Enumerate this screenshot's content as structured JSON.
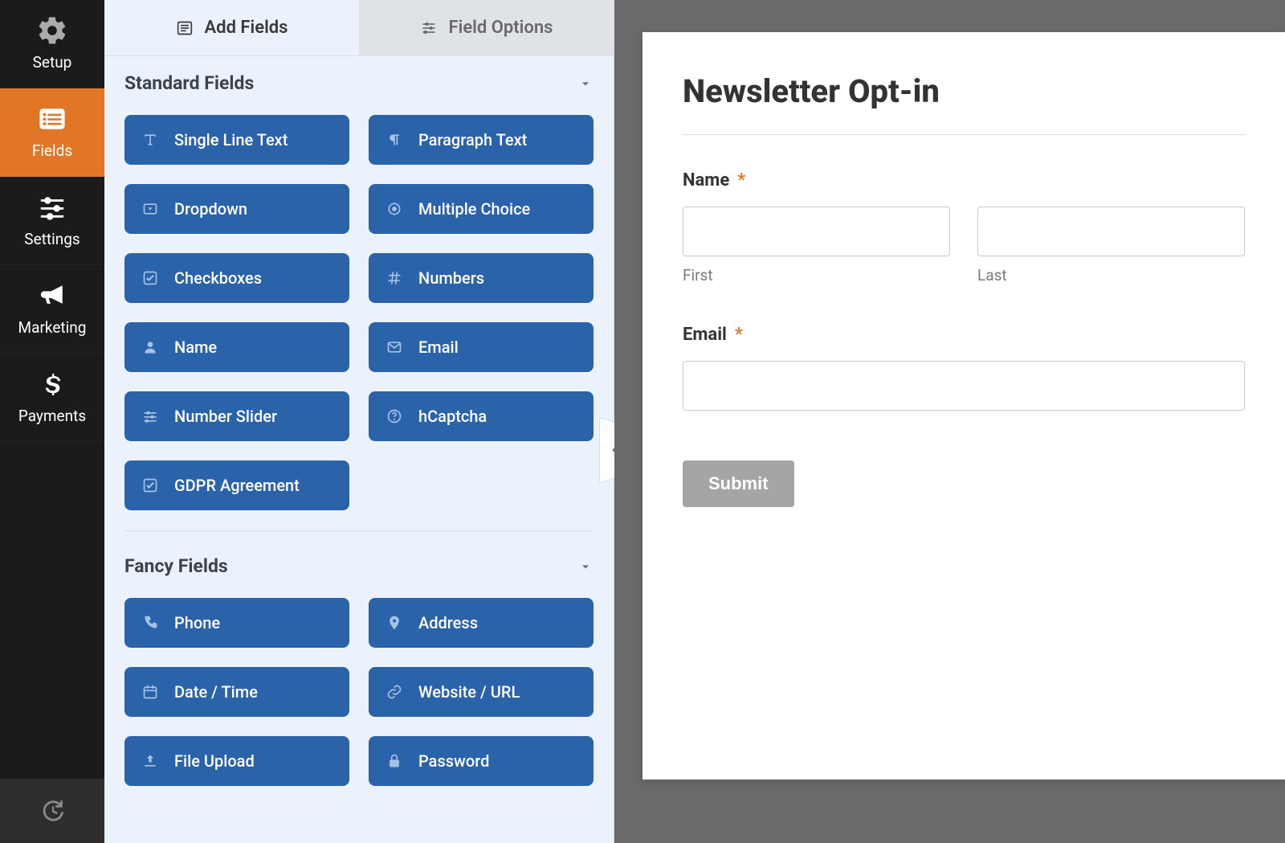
{
  "nav": {
    "items": [
      {
        "id": "setup",
        "label": "Setup"
      },
      {
        "id": "fields",
        "label": "Fields"
      },
      {
        "id": "settings",
        "label": "Settings"
      },
      {
        "id": "marketing",
        "label": "Marketing"
      },
      {
        "id": "payments",
        "label": "Payments"
      }
    ],
    "active_index": 1
  },
  "tabs": {
    "add_fields": "Add Fields",
    "field_options": "Field Options",
    "active": "add_fields"
  },
  "sections": {
    "standard": {
      "title": "Standard Fields",
      "fields": [
        {
          "icon": "text",
          "label": "Single Line Text"
        },
        {
          "icon": "paragraph",
          "label": "Paragraph Text"
        },
        {
          "icon": "dropdown",
          "label": "Dropdown"
        },
        {
          "icon": "radio",
          "label": "Multiple Choice"
        },
        {
          "icon": "check",
          "label": "Checkboxes"
        },
        {
          "icon": "hash",
          "label": "Numbers"
        },
        {
          "icon": "user",
          "label": "Name"
        },
        {
          "icon": "mail",
          "label": "Email"
        },
        {
          "icon": "sliders",
          "label": "Number Slider"
        },
        {
          "icon": "help",
          "label": "hCaptcha"
        },
        {
          "icon": "check",
          "label": "GDPR Agreement"
        }
      ]
    },
    "fancy": {
      "title": "Fancy Fields",
      "fields": [
        {
          "icon": "phone",
          "label": "Phone"
        },
        {
          "icon": "pin",
          "label": "Address"
        },
        {
          "icon": "calendar",
          "label": "Date / Time"
        },
        {
          "icon": "link",
          "label": "Website / URL"
        },
        {
          "icon": "upload",
          "label": "File Upload"
        },
        {
          "icon": "lock",
          "label": "Password"
        }
      ]
    }
  },
  "preview": {
    "form_title": "Newsletter Opt-in",
    "name": {
      "label": "Name",
      "first_sub": "First",
      "last_sub": "Last",
      "first_value": "",
      "last_value": ""
    },
    "email": {
      "label": "Email",
      "value": ""
    },
    "submit": "Submit"
  }
}
